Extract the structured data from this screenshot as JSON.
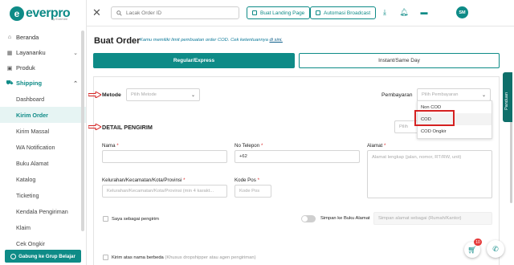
{
  "brand": {
    "name": "everpro",
    "sub": "by Everhire"
  },
  "sidebar": {
    "items": [
      {
        "label": "Beranda",
        "icon": "home-icon"
      },
      {
        "label": "Layananku",
        "icon": "grid-icon"
      },
      {
        "label": "Produk",
        "icon": "box-icon"
      },
      {
        "label": "Shipping",
        "icon": "truck-icon"
      }
    ],
    "sub_items": [
      "Dashboard",
      "Kirim Order",
      "Kirim Massal",
      "WA Notification",
      "Buku Alamat",
      "Katalog",
      "Ticketing",
      "Kendala Pengiriman",
      "Klaim",
      "Cek Ongkir"
    ],
    "join_button": "Gabung ke Grup Belajar"
  },
  "topbar": {
    "search_placeholder": "Lacak Order ID",
    "landing_button": "Buat Landing Page",
    "broadcast_button": "Automasi Broadcast",
    "avatar_initials": "SM"
  },
  "main": {
    "title": "Buat Order",
    "note": "Kamu memiliki limit pembuatan order COD. Cek ketentuannya",
    "note_link": "di sini.",
    "tabs": [
      "Regular/Express",
      "Instant/Same Day"
    ]
  },
  "form": {
    "metode_label": "Metode",
    "metode_placeholder": "Pilih Metode",
    "pembayaran_label": "Pembayaran",
    "pembayaran_placeholder": "Pilih Pembayaran",
    "payment_options": [
      "Non COD",
      "COD",
      "COD Ongkir"
    ],
    "section_title": "DETAIL PENGIRIM",
    "search_hint": "Pilih",
    "nama_label": "Nama",
    "telepon_label": "No Telepon",
    "telepon_prefix": "+62",
    "alamat_label": "Alamat",
    "alamat_placeholder": "Alamat lengkap (jalan, nomor, RT/RW, unit)",
    "kelurahan_label": "Kelurahan/Kecamatan/Kota/Provinsi",
    "kelurahan_placeholder": "Kelurahan/Kecamatan/Kota/Provinsi (min 4 karakt...",
    "kodepos_label": "Kode Pos",
    "kodepos_placeholder": "Kode Pos",
    "sebagai_pengirim": "Saya sebagai pengirim",
    "simpan_label": "Simpan ke Buku Alamat",
    "simpan_placeholder": "Simpan alamat sebagai (Rumah/Kantor)",
    "kirim_berbeda": "Kirim atas nama berbeda",
    "kirim_berbeda_hint": "(Khusus dropshipper atau agen pengiriman)",
    "required_mark": "*"
  },
  "side_tab": "Panduan",
  "fab_badge": "10"
}
